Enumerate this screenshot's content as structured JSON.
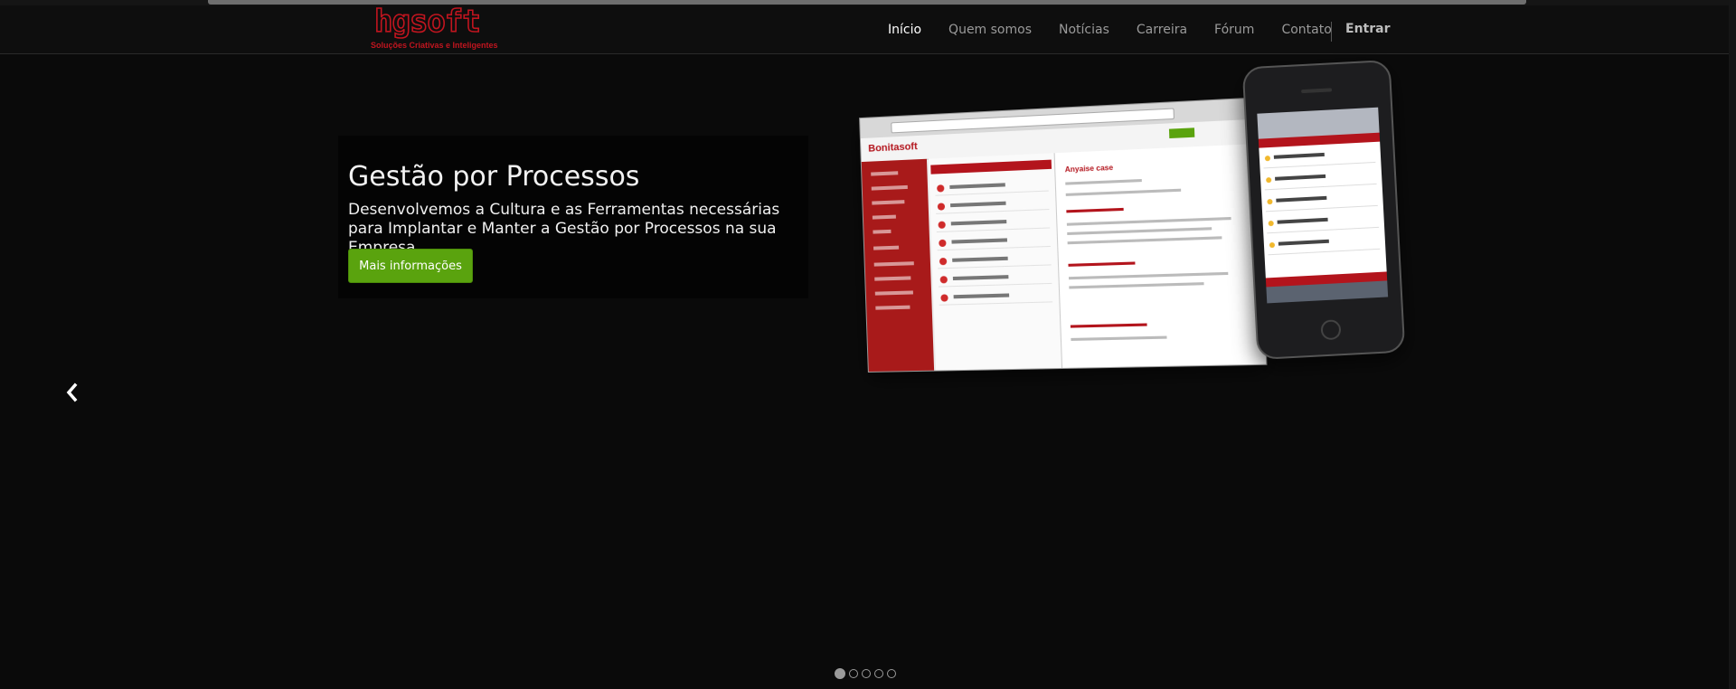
{
  "brand": {
    "logo_text": "hgsoft",
    "tagline": "Soluções Criativas e Inteligentes",
    "color": "#c1151f"
  },
  "nav": {
    "items": [
      {
        "label": "Início",
        "active": true
      },
      {
        "label": "Quem somos",
        "active": false
      },
      {
        "label": "Notícias",
        "active": false
      },
      {
        "label": "Carreira",
        "active": false
      },
      {
        "label": "Fórum",
        "active": false
      },
      {
        "label": "Contato",
        "active": false
      }
    ],
    "login_label": "Entrar"
  },
  "carousel": {
    "headline": "Gestão por Processos",
    "subtext": "Desenvolvemos a Cultura e as Ferramentas necessárias para Implantar e Manter a Gestão por Processos na sua Empresa.",
    "cta_label": "Mais informações",
    "cta_color": "#5aa30e",
    "prev_icon": "chevron-left-icon",
    "slide_count": 5,
    "active_slide": 1
  },
  "mockup": {
    "app_brand": "Bonitasoft",
    "detail_title": "Anyaise case"
  }
}
